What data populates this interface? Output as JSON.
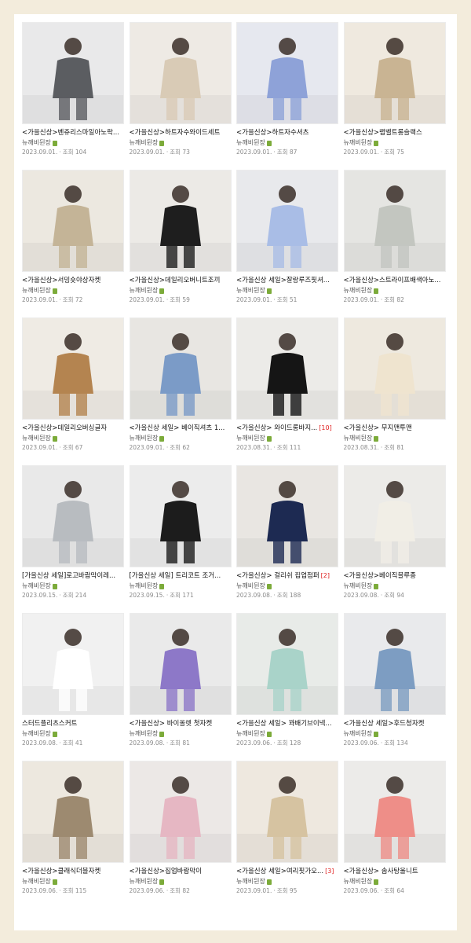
{
  "rows": [
    [
      {
        "title": "<가을신상>벤쥬리스마일아노락...",
        "author": "뉴깨비뒨장",
        "date": "2023.09.01.",
        "views": "조회 104",
        "bg": "#e9e9ea",
        "figure": "#5b5d61",
        "count": ""
      },
      {
        "title": "<가을신상>하트자수와이드세트",
        "author": "뉴깨비뒨장",
        "date": "2023.09.01.",
        "views": "조회 73",
        "bg": "#eeeae4",
        "figure": "#d9cbb6",
        "count": ""
      },
      {
        "title": "<가을신상>하트자수셔츠",
        "author": "뉴깨비뒨장",
        "date": "2023.09.01.",
        "views": "조회 87",
        "bg": "#e6e8ef",
        "figure": "#8ea2d8",
        "count": ""
      },
      {
        "title": "<가을신상>랩벨트롱슬랙스",
        "author": "뉴깨비뒨장",
        "date": "2023.09.01.",
        "views": "조회 75",
        "bg": "#efe9df",
        "figure": "#c9b493",
        "count": ""
      }
    ],
    [
      {
        "title": "<가을신상>서밍숏야상자켓",
        "author": "뉴깨비뒨장",
        "date": "2023.09.01.",
        "views": "조회 72",
        "bg": "#ece8e0",
        "figure": "#c4b497",
        "count": ""
      },
      {
        "title": "<가을신상>데일리오버니트조끼",
        "author": "뉴깨비뒨장",
        "date": "2023.09.01.",
        "views": "조회 59",
        "bg": "#eceae6",
        "figure": "#1e1e1e",
        "count": ""
      },
      {
        "title": "<가을신상 세일>잘랑루즈핏셔...",
        "author": "뉴깨비뒨장",
        "date": "2023.09.01.",
        "views": "조회 51",
        "bg": "#e8e9ec",
        "figure": "#a9bde6",
        "count": ""
      },
      {
        "title": "<가을신상>스트라이프배색아노...",
        "author": "뉴깨비뒨장",
        "date": "2023.09.01.",
        "views": "조회 82",
        "bg": "#e5e5e2",
        "figure": "#c3c6c0",
        "count": ""
      }
    ],
    [
      {
        "title": "<가을신상>데일리오버싱글자",
        "author": "뉴깨비뒨장",
        "date": "2023.09.01.",
        "views": "조회 67",
        "bg": "#efebe4",
        "figure": "#b48450",
        "count": ""
      },
      {
        "title": "<가을신상 세일> 베이직셔츠 1...",
        "author": "뉴깨비뒨장",
        "date": "2023.09.01.",
        "views": "조회 62",
        "bg": "#e8e6e2",
        "figure": "#7b9bc7",
        "count": ""
      },
      {
        "title": "<가을신상> 와이드롱바지...",
        "author": "뉴깨비뒨장",
        "date": "2023.08.31.",
        "views": "조회 111",
        "bg": "#ecebe8",
        "figure": "#151515",
        "count": "[10]"
      },
      {
        "title": "<가을신상> 무지맨투맨",
        "author": "뉴깨비뒨장",
        "date": "2023.08.31.",
        "views": "조회 81",
        "bg": "#eee9df",
        "figure": "#efe4cf",
        "count": ""
      }
    ],
    [
      {
        "title": "[가을신상 세일]로고바람막이레...",
        "author": "뉴깨비뒨장",
        "date": "2023.09.15.",
        "views": "조회 214",
        "bg": "#e9e9e9",
        "figure": "#b8bcc0",
        "count": ""
      },
      {
        "title": "[가을신상 세일] 트리코트 조거...",
        "author": "뉴깨비뒨장",
        "date": "2023.09.15.",
        "views": "조회 171",
        "bg": "#ececec",
        "figure": "#1c1c1c",
        "count": ""
      },
      {
        "title": "<가을신상> 걸리쉬 집업점퍼",
        "author": "뉴깨비뒨장",
        "date": "2023.09.08.",
        "views": "조회 188",
        "bg": "#e9e6e2",
        "figure": "#1d2a52",
        "count": "[2]"
      },
      {
        "title": "<가을신상>베이직블루종",
        "author": "뉴깨비뒨장",
        "date": "2023.09.08.",
        "views": "조회 94",
        "bg": "#ecebe8",
        "figure": "#f1eee6",
        "count": ""
      }
    ],
    [
      {
        "title": "스터드플리츠스커트",
        "author": "뉴깨비뒨장",
        "date": "2023.09.08.",
        "views": "조회 41",
        "bg": "#f1f1f1",
        "figure": "#ffffff",
        "count": ""
      },
      {
        "title": "<가을신상> 바이올렛 첫자켓",
        "author": "뉴깨비뒨장",
        "date": "2023.09.08.",
        "views": "조회 81",
        "bg": "#eaeaea",
        "figure": "#8d78c8",
        "count": ""
      },
      {
        "title": "<가을신상 세일> 꽈배기브이넥...",
        "author": "뉴깨비뒨장",
        "date": "2023.09.06.",
        "views": "조회 128",
        "bg": "#e8ebe8",
        "figure": "#a9d3c9",
        "count": ""
      },
      {
        "title": "<가을신상 세일>후드청자켓",
        "author": "뉴깨비뒨장",
        "date": "2023.09.06.",
        "views": "조회 134",
        "bg": "#e9eaec",
        "figure": "#7d9dc2",
        "count": ""
      }
    ],
    [
      {
        "title": "<가을신상>클래식더블자켓",
        "author": "뉴깨비뒨장",
        "date": "2023.09.06.",
        "views": "조회 115",
        "bg": "#ede8df",
        "figure": "#9d8a70",
        "count": ""
      },
      {
        "title": "<가을신상>집업바람막이",
        "author": "뉴깨비뒨장",
        "date": "2023.09.06.",
        "views": "조회 82",
        "bg": "#ece8e6",
        "figure": "#e6b7c3",
        "count": ""
      },
      {
        "title": "<가을신상 세일>여리핏가오...",
        "author": "뉴깨비뒨장",
        "date": "2023.09.01.",
        "views": "조회 95",
        "bg": "#eee8df",
        "figure": "#d6c3a1",
        "count": "[3]"
      },
      {
        "title": "<가을신상> 솜사탕울니트",
        "author": "뉴깨비뒨장",
        "date": "2023.09.06.",
        "views": "조회 64",
        "bg": "#ecebe9",
        "figure": "#ee8e88",
        "count": ""
      }
    ]
  ]
}
